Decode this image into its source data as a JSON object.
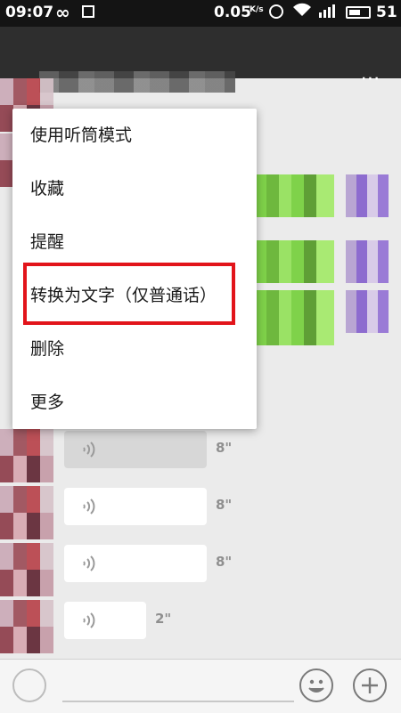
{
  "status_bar": {
    "time": "09:07",
    "link_icon": "∞",
    "speed": "0.05",
    "speed_unit": "K/s",
    "battery": "51"
  },
  "app_bar": {
    "more_label": "⋯"
  },
  "menu": {
    "items": [
      "使用听筒模式",
      "收藏",
      "提醒",
      "转换为文字（仅普通话）",
      "删除",
      "更多"
    ]
  },
  "messages": [
    {
      "duration": "8\""
    },
    {
      "duration": "8\""
    },
    {
      "duration": "8\""
    },
    {
      "duration": "2\""
    }
  ],
  "input_bar": {
    "emoji_icon": "emoji-icon",
    "add_icon": "plus-icon"
  },
  "colors": {
    "highlight": "#e2141a",
    "statusbar": "#141414",
    "appbar": "#2e2e2e"
  }
}
